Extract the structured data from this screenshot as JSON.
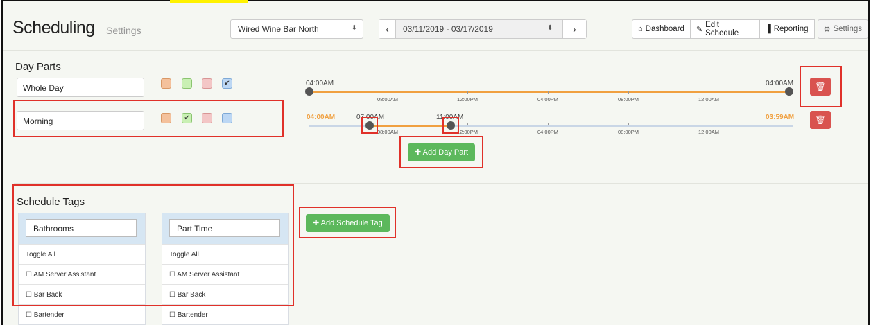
{
  "header": {
    "title": "Scheduling",
    "subtitle": "Settings",
    "location": "Wired Wine Bar North",
    "date_range": "03/11/2019 - 03/17/2019",
    "nav": [
      {
        "label": "Dashboard",
        "icon": "home-icon",
        "glyph": "⌂"
      },
      {
        "label": "Edit Schedule",
        "icon": "edit-icon",
        "glyph": "✎"
      },
      {
        "label": "Reporting",
        "icon": "bar-chart-icon",
        "glyph": "▐"
      },
      {
        "label": "Settings",
        "icon": "gear-icon",
        "glyph": "⚙"
      }
    ]
  },
  "day_parts": {
    "title": "Day Parts",
    "items": [
      {
        "name": "Whole Day",
        "selected_color": "blue",
        "start_label": "04:00AM",
        "end_label": "04:00AM"
      },
      {
        "name": "Morning",
        "selected_color": "green",
        "start_label": "04:00AM",
        "end_label": "03:59AM",
        "handle_start": "07:00AM",
        "handle_end": "11:00AM"
      }
    ],
    "ticks": [
      "08:00AM",
      "12:00PM",
      "04:00PM",
      "08:00PM",
      "12:00AM"
    ],
    "add_label": "Add Day Part",
    "colors": {
      "orange": "#f0a040",
      "green": "#5cb85c",
      "red": "#d9534f",
      "blue": "#337ab7"
    }
  },
  "schedule_tags": {
    "title": "Schedule Tags",
    "add_label": "Add Schedule Tag",
    "columns": [
      {
        "name": "Bathrooms",
        "toggle": "Toggle All",
        "roles": [
          "AM Server Assistant",
          "Bar Back",
          "Bartender"
        ]
      },
      {
        "name": "Part Time",
        "toggle": "Toggle All",
        "roles": [
          "AM Server Assistant",
          "Bar Back",
          "Bartender"
        ]
      }
    ]
  }
}
